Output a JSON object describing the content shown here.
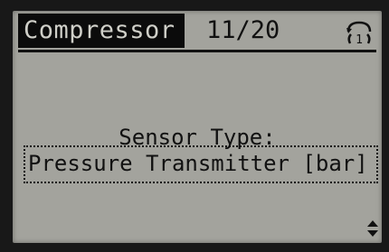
{
  "header": {
    "title": "Compressor",
    "page_counter": "11/20",
    "setup_icon": "active-setup-indicator-icon",
    "setup_number": "1"
  },
  "parameter": {
    "label": "Sensor Type:",
    "value": "Pressure Transmitter [bar]"
  },
  "controls": {
    "scroll_icon": "up-down-scroll-icon"
  },
  "colors": {
    "lcd_background": "#a3a39d",
    "title_background": "#0b0b0b",
    "title_text": "#cfcfc8",
    "text": "#111111",
    "bezel": "#181818"
  }
}
